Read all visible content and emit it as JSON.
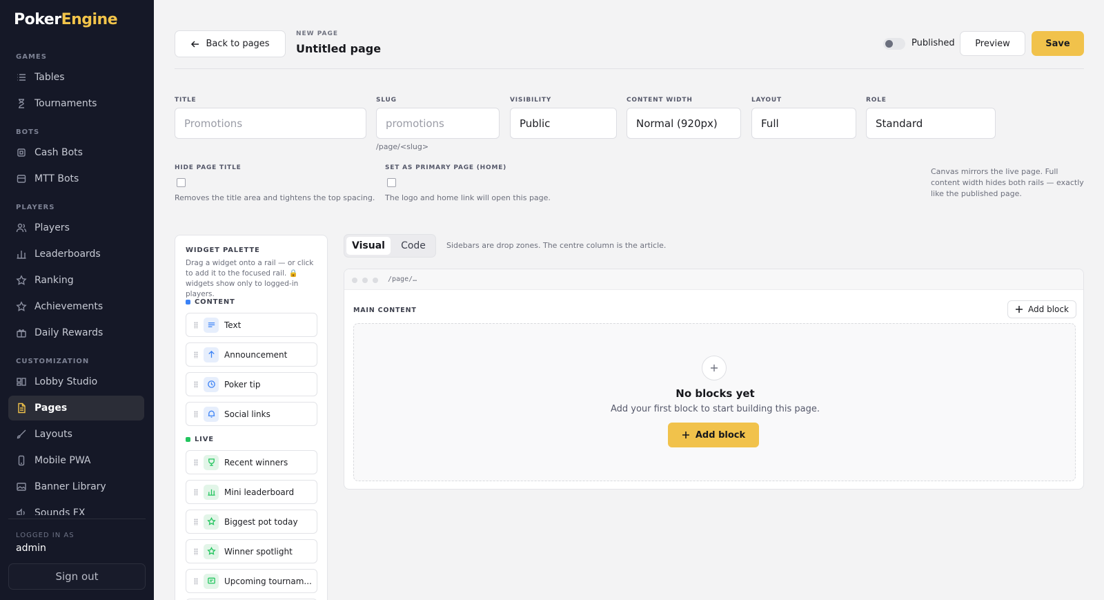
{
  "brand": {
    "part1": "Poker",
    "part2": "Engine"
  },
  "sidebar": {
    "sections": [
      {
        "label": "GAMES"
      },
      {
        "label": "BOTS"
      },
      {
        "label": "PLAYERS"
      },
      {
        "label": "CUSTOMIZATION"
      }
    ],
    "items": [
      {
        "label": "Tables",
        "icon": "list-icon"
      },
      {
        "label": "Tournaments",
        "icon": "hourglass-icon"
      },
      {
        "label": "Cash Bots",
        "icon": "cpu-icon"
      },
      {
        "label": "MTT Bots",
        "icon": "archive-icon"
      },
      {
        "label": "Players",
        "icon": "users-icon"
      },
      {
        "label": "Leaderboards",
        "icon": "bar-chart-icon"
      },
      {
        "label": "Ranking",
        "icon": "star-icon"
      },
      {
        "label": "Achievements",
        "icon": "star-icon"
      },
      {
        "label": "Daily Rewards",
        "icon": "gift-icon"
      },
      {
        "label": "Lobby Studio",
        "icon": "layout-icon"
      },
      {
        "label": "Pages",
        "icon": "file-icon",
        "active": true
      },
      {
        "label": "Layouts",
        "icon": "brush-icon"
      },
      {
        "label": "Mobile PWA",
        "icon": "phone-icon"
      },
      {
        "label": "Banner Library",
        "icon": "image-icon"
      },
      {
        "label": "Sounds FX",
        "icon": "sound-icon"
      }
    ],
    "logged_in_label": "LOGGED IN AS",
    "user": "admin",
    "sign_out": "Sign out"
  },
  "header": {
    "back_label": "Back to pages",
    "new_page_label": "NEW PAGE",
    "page_title": "Untitled page",
    "published_label": "Published",
    "published": false,
    "preview_label": "Preview",
    "save_label": "Save"
  },
  "form": {
    "title": {
      "label": "TITLE",
      "placeholder": "Promotions"
    },
    "slug": {
      "label": "SLUG",
      "placeholder": "promotions",
      "hint": "/page/<slug>"
    },
    "visibility": {
      "label": "VISIBILITY",
      "value": "Public"
    },
    "content_width": {
      "label": "CONTENT WIDTH",
      "value": "Normal (920px)"
    },
    "layout": {
      "label": "LAYOUT",
      "value": "Full"
    },
    "role": {
      "label": "ROLE",
      "value": "Standard"
    },
    "hide_title": {
      "label": "HIDE PAGE TITLE",
      "help": "Removes the title area and tightens the top spacing."
    },
    "primary": {
      "label": "SET AS PRIMARY PAGE (HOME)",
      "help": "The logo and home link will open this page."
    },
    "canvas_note": "Canvas mirrors the live page. Full content width hides both rails — exactly like the published page."
  },
  "palette": {
    "title": "WIDGET PALETTE",
    "description": "Drag a widget onto a rail — or click to add it to the focused rail. 🔒 widgets show only to logged-in players.",
    "content_label": "CONTENT",
    "live_label": "LIVE",
    "content_widgets": [
      "Text",
      "Announcement",
      "Poker tip",
      "Social links"
    ],
    "live_widgets": [
      "Recent winners",
      "Mini leaderboard",
      "Biggest pot today",
      "Winner spotlight",
      "Upcoming tournam..."
    ],
    "colors": {
      "content": "#3b82f6",
      "live": "#22c55e"
    }
  },
  "editor": {
    "tab_visual": "Visual",
    "tab_code": "Code",
    "hint": "Sidebars are drop zones. The centre column is the article.",
    "path": "/page/…",
    "main_label": "MAIN CONTENT",
    "add_block": "Add block",
    "empty_title": "No blocks yet",
    "empty_desc": "Add your first block to start building this page.",
    "add_block_primary": "Add block"
  },
  "colors": {
    "accent": "#f1c24b",
    "sidebar_bg": "#151827"
  }
}
